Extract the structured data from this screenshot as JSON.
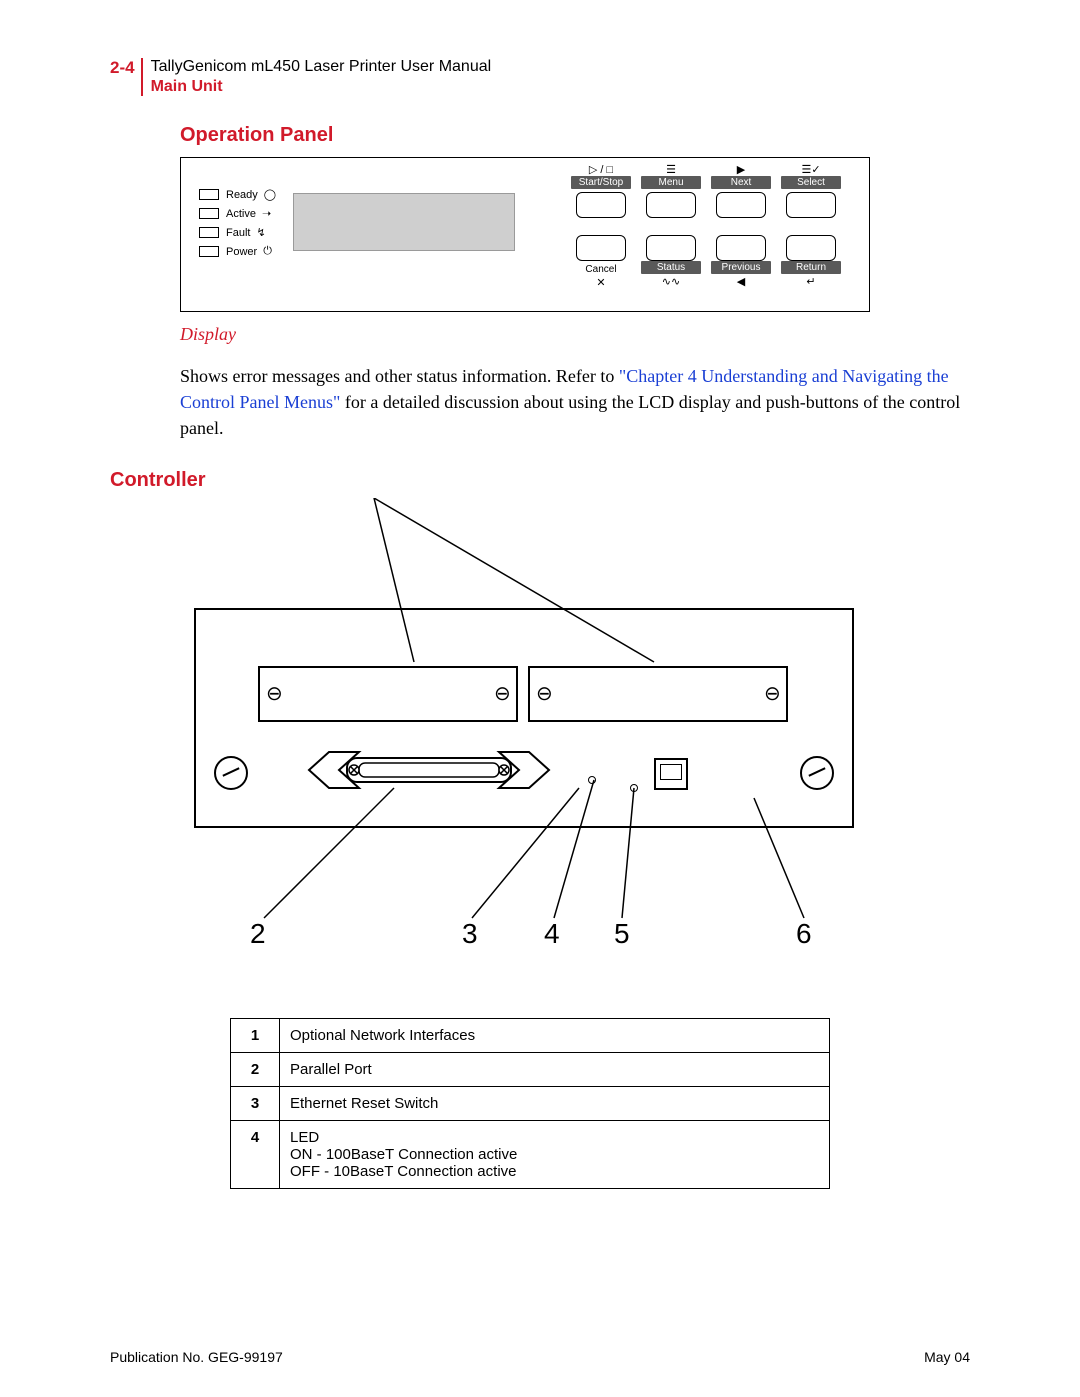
{
  "header": {
    "page_number": "2-4",
    "doc_title": "TallyGenicom mL450 Laser Printer User Manual",
    "section": "Main Unit"
  },
  "sections": {
    "operation_panel_heading": "Operation Panel",
    "display_heading": "Display",
    "display_text_1": "Shows error messages and other status information. Refer to ",
    "display_link": "\"Chapter 4 Understanding and Navigating the Control Panel Menus\"",
    "display_text_2": " for a detailed discussion about using the LCD display and push-buttons of the control panel.",
    "controller_heading": "Controller"
  },
  "op_panel": {
    "leds": [
      {
        "label": "Ready",
        "icon": "◯"
      },
      {
        "label": "Active",
        "icon": "➝"
      },
      {
        "label": "Fault",
        "icon": "↯"
      },
      {
        "label": "Power",
        "icon": "⏻"
      }
    ],
    "top_buttons": [
      {
        "icon": "▷ / □",
        "label": "Start/Stop"
      },
      {
        "icon": "☰",
        "label": "Menu"
      },
      {
        "icon": "▶",
        "label": "Next"
      },
      {
        "icon": "☰✓",
        "label": "Select"
      }
    ],
    "bottom_buttons": [
      {
        "label": "Cancel",
        "icon": "✕",
        "dark": false
      },
      {
        "label": "Status",
        "icon": "∿∿",
        "dark": true
      },
      {
        "label": "Previous",
        "icon": "◀",
        "dark": true
      },
      {
        "label": "Return",
        "icon": "↵",
        "dark": true
      }
    ]
  },
  "controller_callouts": [
    "2",
    "3",
    "4",
    "5",
    "6"
  ],
  "parts_table": [
    {
      "n": "1",
      "text": "Optional Network Interfaces"
    },
    {
      "n": "2",
      "text": "Parallel Port"
    },
    {
      "n": "3",
      "text": "Ethernet Reset Switch"
    },
    {
      "n": "4",
      "text": "LED\nON - 100BaseT Connection active\nOFF - 10BaseT Connection active"
    }
  ],
  "footer": {
    "left": "Publication No. GEG-99197",
    "right": "May 04"
  }
}
